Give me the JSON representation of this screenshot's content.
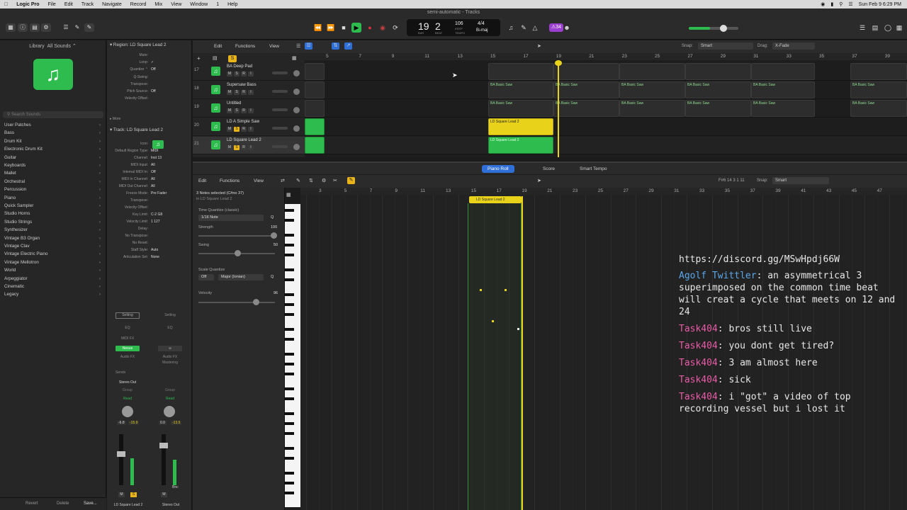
{
  "menubar": {
    "app": "Logic Pro",
    "items": [
      "File",
      "Edit",
      "Track",
      "Navigate",
      "Record",
      "Mix",
      "View",
      "Window",
      "1",
      "Help"
    ],
    "clock": "Sun Feb 9  6:29 PM"
  },
  "window": {
    "title": "semi-automatic - Tracks"
  },
  "lcd": {
    "bar": "19",
    "beat": "2",
    "tempo": "106",
    "tempo_label": "KEEP",
    "signature": "4/4",
    "key": "B♭maj",
    "bar_label": "BAR",
    "beat_label": "BEAT",
    "tempo_sub": "TEMPO"
  },
  "control": {
    "badge": "⚠34"
  },
  "library": {
    "title": "Library",
    "sounds": "All Sounds ⌃",
    "search_placeholder": "Search Sounds",
    "items": [
      "User Patches",
      "Bass",
      "Drum Kit",
      "Electronic Drum Kit",
      "Guitar",
      "Keyboards",
      "Mallet",
      "Orchestral",
      "Percussion",
      "Piano",
      "Quick Sampler",
      "Studio Horns",
      "Studio Strings",
      "Synthesizer",
      "Vintage B3 Organ",
      "Vintage Clav",
      "Vintage Electric Piano",
      "Vintage Mellotron",
      "World",
      "Arpeggiator",
      "Cinematic",
      "Legacy"
    ],
    "footer": {
      "revert": "Revert",
      "delete": "Delete",
      "save": "Save..."
    }
  },
  "inspector": {
    "region_header": "Region:",
    "region_name": "LD Square Lead 2",
    "region_rows": [
      {
        "k": "Mute:",
        "v": ""
      },
      {
        "k": "Loop:",
        "v": "✓"
      },
      {
        "k": "Quantize ⌃",
        "v": "Off"
      },
      {
        "k": "Q-Swing:",
        "v": ""
      },
      {
        "k": "Transpose:",
        "v": ""
      },
      {
        "k": "Pitch Source:",
        "v": "Off"
      },
      {
        "k": "Velocity Offset:",
        "v": ""
      }
    ],
    "more": "More",
    "track_header": "Track:",
    "track_name": "LD Square Lead 2",
    "track_rows": [
      {
        "k": "Icon:",
        "v": ""
      },
      {
        "k": "Default Region Type:",
        "v": "MIDI"
      },
      {
        "k": "Channel:",
        "v": "Inst 13"
      },
      {
        "k": "MIDI Input:",
        "v": "All"
      },
      {
        "k": "Internal MIDI In:",
        "v": "Off"
      },
      {
        "k": "MIDI In Channel:",
        "v": "All"
      },
      {
        "k": "MIDI Out Channel:",
        "v": "All"
      },
      {
        "k": "Freeze Mode:",
        "v": "Pre Fader"
      },
      {
        "k": "Transpose:",
        "v": ""
      },
      {
        "k": "Velocity Offset:",
        "v": ""
      },
      {
        "k": "Key Limit:",
        "v": "C-2  G8"
      },
      {
        "k": "Velocity Limit:",
        "v": "1  127"
      },
      {
        "k": "Delay:",
        "v": ""
      },
      {
        "k": "No Transpose:",
        "v": ""
      },
      {
        "k": "No Reset:",
        "v": ""
      },
      {
        "k": "Staff Style:",
        "v": "Auto"
      },
      {
        "k": "Articulation Set:",
        "v": "None"
      }
    ],
    "strips": {
      "setting": "Setting",
      "eq": "EQ",
      "midi_fx": "MIDI FX",
      "nexus": "Nexus",
      "audio_fx": "Audio FX",
      "audio_fx2": "Mastering",
      "sends": "Sends",
      "stereo_out": "Stereo Out",
      "group": "Group",
      "read1": "Read",
      "read2": "Read",
      "vol1": "-6.8",
      "pk1": "-15.9",
      "vol2": "0.0",
      "pk2": "-13.5",
      "bnc": "Bnc",
      "m": "M",
      "s": "S",
      "name1": "LD Square Lead 2",
      "name2": "Stereo Out"
    }
  },
  "tracks_toolbar": {
    "edit": "Edit",
    "functions": "Functions",
    "view": "View",
    "snap_label": "Snap:",
    "snap": "Smart",
    "drag_label": "Drag:",
    "drag": "X-Fade"
  },
  "ruler_top": [
    "5",
    "7",
    "9",
    "11",
    "13",
    "15",
    "17",
    "19",
    "21",
    "23",
    "25",
    "27",
    "29",
    "31",
    "33",
    "35",
    "37",
    "39"
  ],
  "tracks": [
    {
      "num": "17",
      "name": "BA Deep Pad"
    },
    {
      "num": "18",
      "name": "Supersaw Bass"
    },
    {
      "num": "19",
      "name": "Untitled"
    },
    {
      "num": "20",
      "name": "LD A Simple Saw"
    },
    {
      "num": "21",
      "name": "LD Square Lead 2"
    }
  ],
  "regions": {
    "ba_basic": "BA Basic Saw",
    "ld_square": "LD Square Lead 2"
  },
  "editor": {
    "tabs": [
      "Piano Roll",
      "Score",
      "Smart Tempo"
    ],
    "edit": "Edit",
    "functions": "Functions",
    "view": "View",
    "note_info": "F#6  14 3 1 11",
    "snap_label": "Snap:",
    "snap": "Smart",
    "selection": "3 Notes selected (C#no 37)",
    "selection_sub": "in LD Square Lead 2",
    "time_quantize_label": "Time Quantize (classic)",
    "time_quantize": "1/16 Note",
    "q": "Q",
    "strength_label": "Strength",
    "strength": "100",
    "swing_label": "Swing",
    "swing": "50",
    "scale_quantize_label": "Scale Quantize",
    "scale_off": "Off",
    "scale": "Major (Ionian)",
    "velocity_label": "Velocity",
    "velocity": "96",
    "region_label": "LD Square Lead 2",
    "ruler": [
      "3",
      "5",
      "7",
      "9",
      "11",
      "13",
      "15",
      "17",
      "19",
      "21",
      "23",
      "25",
      "27",
      "29",
      "31",
      "33",
      "35",
      "37",
      "39",
      "41",
      "43",
      "45",
      "47"
    ]
  },
  "chat": {
    "link": "https://discord.gg/MSwHpdj66W",
    "messages": [
      {
        "user": "Agolf Twittler",
        "text": " an asymmetrical 3 superimposed on the common time beat will creat a cycle that meets on 12 and 24",
        "color": "blue"
      },
      {
        "user": "Task404",
        "text": " bros still live",
        "color": "pink"
      },
      {
        "user": "Task404",
        "text": " you dont get tired?",
        "color": "pink"
      },
      {
        "user": "Task404",
        "text": " 3 am almost here",
        "color": "pink"
      },
      {
        "user": "Task404",
        "text": " sick",
        "color": "pink"
      },
      {
        "user": "Task404",
        "text": " i \"got\" a video of top recording vessel but i lost it",
        "color": "pink"
      }
    ]
  },
  "colors": {
    "accent": "#2f6fd8",
    "green": "#2ebc4f",
    "yellow": "#e8d21a",
    "play": "#2ebc4f",
    "record": "#e0303a"
  }
}
